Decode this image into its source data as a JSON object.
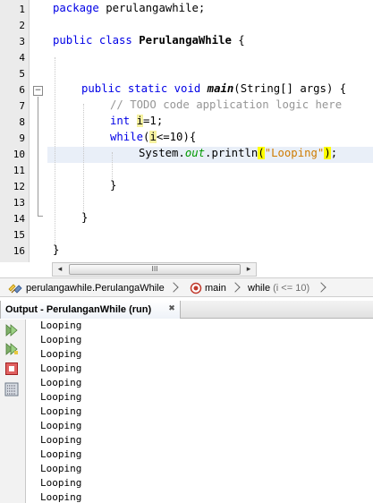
{
  "editor": {
    "line_numbers": [
      "1",
      "2",
      "3",
      "4",
      "5",
      "6",
      "7",
      "8",
      "9",
      "10",
      "11",
      "12",
      "13",
      "14",
      "15",
      "16"
    ],
    "line1": {
      "kw": "package",
      "rest": " perulangawhile;"
    },
    "line3": {
      "kw": "public class",
      "name": "PerulangaWhile",
      "rest": " {"
    },
    "line6": {
      "kw": "public static void",
      "method": "main",
      "rest": "(String[] args) {"
    },
    "line7": {
      "comment": "// TODO code application logic here"
    },
    "line8": {
      "kw": "int",
      "var": "i",
      "rest": "=1;"
    },
    "line9": {
      "kw": "while",
      "open": "(",
      "var": "i",
      "rest": "<=10){"
    },
    "line10": {
      "pre": "System.",
      "field": "out",
      "mid": ".println",
      "open": "(",
      "str": "\"Looping\"",
      "close": ")",
      "end": ";"
    },
    "line12": {
      "text": "}"
    },
    "line14": {
      "text": "}"
    },
    "line16": {
      "text": "}"
    },
    "fold_minus": "−",
    "fold_plus": "+"
  },
  "scrollbar": {
    "left_arrow": "◂",
    "right_arrow": "▸",
    "grip": "III"
  },
  "breadcrumb": {
    "class_path": "perulangawhile.PerulangaWhile",
    "method": "main",
    "loop": "while",
    "loop_cond": "(i <= 10)"
  },
  "output": {
    "tab_title": "Output - PerulanganWhile (run)",
    "close_glyph": "✖",
    "lines": [
      "Looping",
      "Looping",
      "Looping",
      "Looping",
      "Looping",
      "Looping",
      "Looping",
      "Looping",
      "Looping",
      "Looping",
      "Looping",
      "Looping",
      "Looping"
    ]
  },
  "colors": {
    "keyword": "#0000e6",
    "comment": "#969696",
    "string": "#ce7b00",
    "field": "#009900",
    "current_line": "#e9eff8",
    "match_highlight": "#ffff00"
  }
}
